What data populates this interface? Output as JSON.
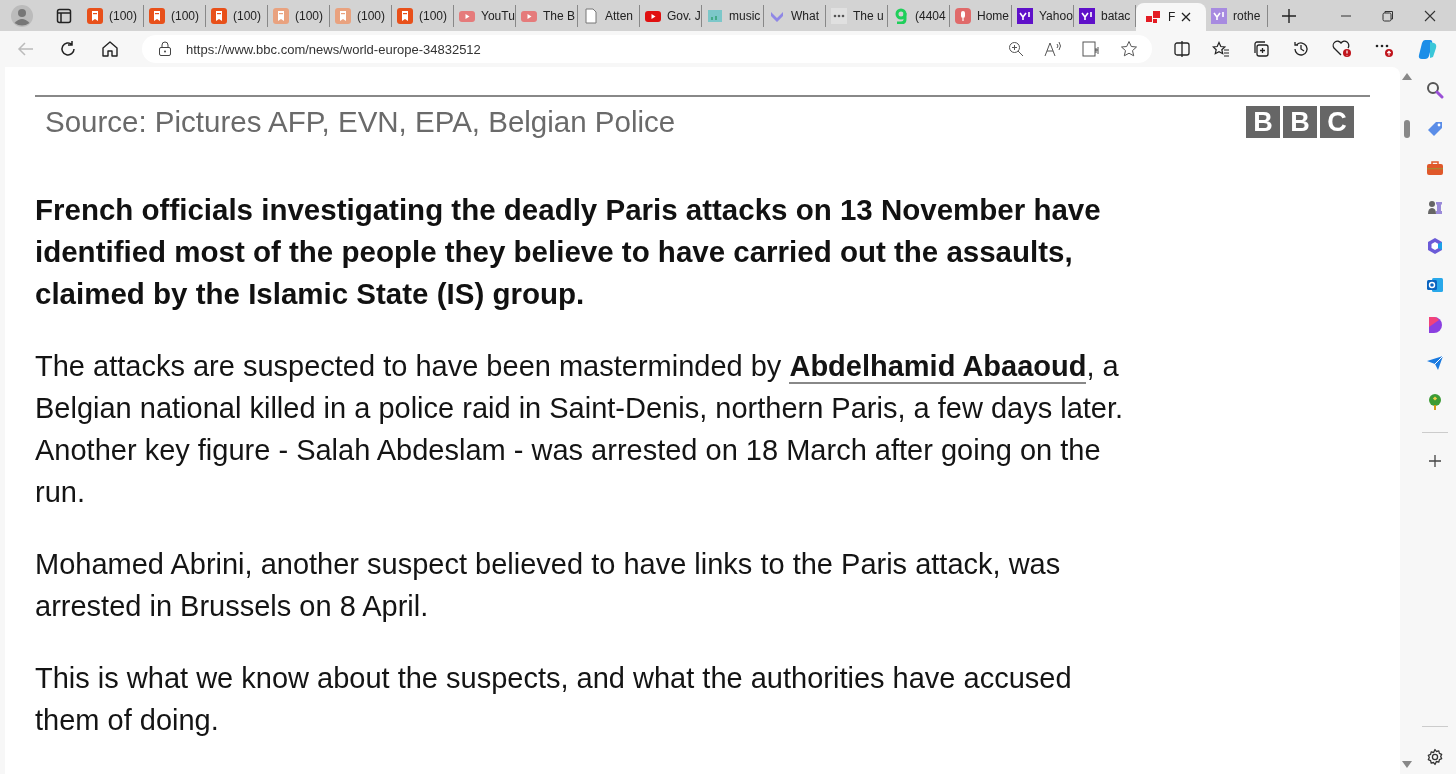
{
  "tabs": [
    {
      "label": "(100)",
      "kind": "bookmark",
      "selected": false
    },
    {
      "label": "(100)",
      "kind": "bookmark",
      "selected": false
    },
    {
      "label": "(100)",
      "kind": "bookmark",
      "selected": false
    },
    {
      "label": "(100)",
      "kind": "bookmark-faded",
      "selected": false
    },
    {
      "label": "(100)",
      "kind": "bookmark-faded",
      "selected": false
    },
    {
      "label": "(100)",
      "kind": "bookmark",
      "selected": false
    },
    {
      "label": "YouTu",
      "kind": "play-faded",
      "selected": false
    },
    {
      "label": "The B",
      "kind": "play-faded",
      "selected": false
    },
    {
      "label": "Atten",
      "kind": "document",
      "selected": false
    },
    {
      "label": "Gov. J",
      "kind": "play",
      "selected": false
    },
    {
      "label": "music",
      "kind": "chart",
      "selected": false
    },
    {
      "label": "What",
      "kind": "shield",
      "selected": false
    },
    {
      "label": "The u",
      "kind": "dots",
      "selected": false
    },
    {
      "label": "(4404",
      "kind": "letter-g",
      "selected": false
    },
    {
      "label": "Home",
      "kind": "microphone",
      "selected": false
    },
    {
      "label": "Yahoo",
      "kind": "yahoo",
      "selected": false
    },
    {
      "label": "batac",
      "kind": "yahoo",
      "selected": false
    },
    {
      "label": "F",
      "kind": "squares",
      "selected": true
    },
    {
      "label": "rothe",
      "kind": "yahoo-faded",
      "selected": false
    }
  ],
  "address": {
    "value": "https://www.bbc.com/news/world-europe-34832512"
  },
  "article": {
    "caption": "Source: Pictures AFP, EVN, EPA, Belgian Police",
    "logo_letters": [
      "B",
      "B",
      "C"
    ],
    "paragraphs": [
      {
        "kind": "lead",
        "parts": [
          {
            "text": "French officials investigating the deadly Paris attacks on 13 November have identified most of the people they believe to have carried out the assaults, claimed by the Islamic State (IS) group."
          }
        ]
      },
      {
        "kind": "body",
        "parts": [
          {
            "text": "The attacks are suspected to have been masterminded by "
          },
          {
            "text": "Abdelhamid Abaaoud",
            "link": true
          },
          {
            "text": ", a Belgian national killed in a police raid in Saint-Denis, northern Paris, a few days later. Another key figure - Salah Abdeslam - was arrested on 18 March after going on the run."
          }
        ]
      },
      {
        "kind": "body",
        "parts": [
          {
            "text": "Mohamed Abrini, another suspect believed to have links to the Paris attack, was arrested in Brussels on 8 April."
          }
        ]
      },
      {
        "kind": "body",
        "parts": [
          {
            "text": "This is what we know about the suspects, and what the authorities have accused them of doing."
          }
        ]
      }
    ]
  }
}
